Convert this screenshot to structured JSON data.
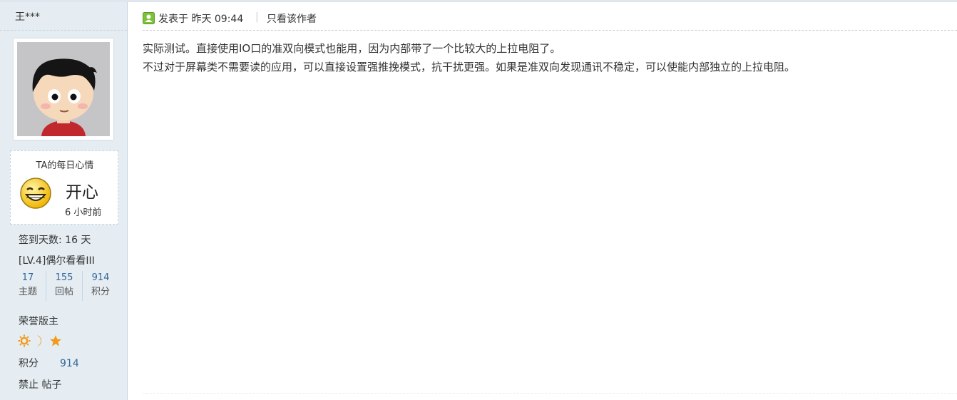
{
  "user": {
    "name": "王***",
    "avatar_icon": "cartoon-boy-avatar"
  },
  "mood": {
    "title": "TA的每日心情",
    "icon": "laughing-face-icon",
    "text": "开心",
    "time": "6 小时前"
  },
  "profile": {
    "checkin": "签到天数: 16 天",
    "level": "[LV.4]偶尔看看III",
    "stats": [
      {
        "num": "17",
        "label": "主题"
      },
      {
        "num": "155",
        "label": "回帖"
      },
      {
        "num": "914",
        "label": "积分"
      }
    ],
    "group": "荣誉版主",
    "medal_icons": [
      "sun-icon",
      "moon-icon",
      "star-icon"
    ],
    "score_label": "积分",
    "score_value": "914",
    "actions": "禁止 帖子"
  },
  "post": {
    "posted_label": "发表于",
    "posted_time": "昨天 09:44",
    "separator": "|",
    "author_only": "只看该作者",
    "lines": [
      "实际测试。直接使用IO口的准双向模式也能用，因为内部带了一个比较大的上拉电阻了。",
      "不过对于屏幕类不需要读的应用，可以直接设置强推挽模式，抗干扰更强。如果是准双向发现通讯不稳定，可以使能内部独立的上拉电阻。"
    ]
  },
  "colors": {
    "sidebar_bg": "#e5edf2",
    "link": "#336699",
    "medal": "#f39a1b"
  }
}
